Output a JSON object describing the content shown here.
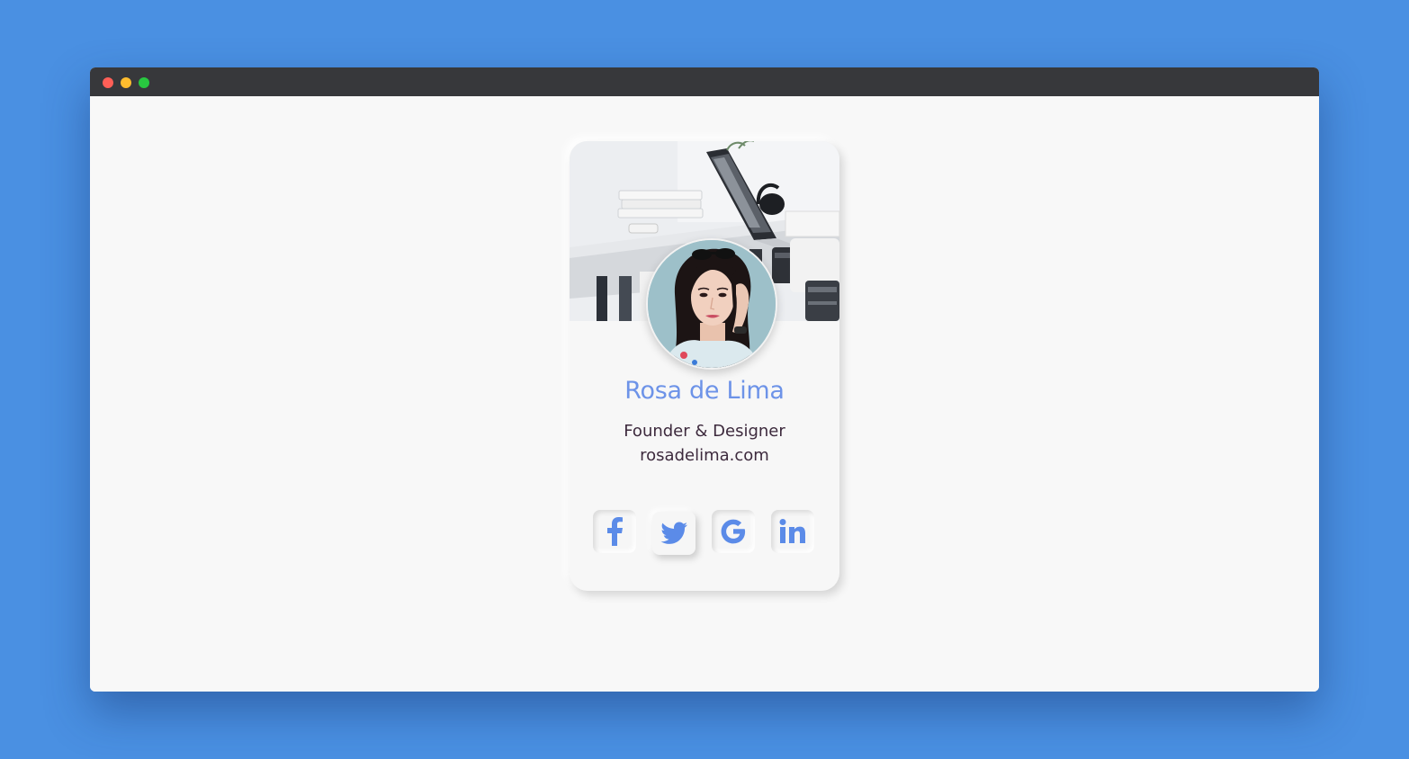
{
  "profile": {
    "name": "Rosa de Lima",
    "role": "Founder & Designer",
    "website": "rosadelima.com"
  },
  "window_controls": [
    "close",
    "minimize",
    "maximize"
  ],
  "socials": [
    {
      "name": "facebook",
      "icon": "facebook-icon"
    },
    {
      "name": "twitter",
      "icon": "twitter-icon"
    },
    {
      "name": "google",
      "icon": "google-icon"
    },
    {
      "name": "linkedin",
      "icon": "linkedin-icon"
    }
  ],
  "colors": {
    "background": "#4a90e2",
    "titlebar": "#37383b",
    "card": "#f7f7f7",
    "accent": "#6d93e8",
    "text": "#3d2a3d"
  }
}
